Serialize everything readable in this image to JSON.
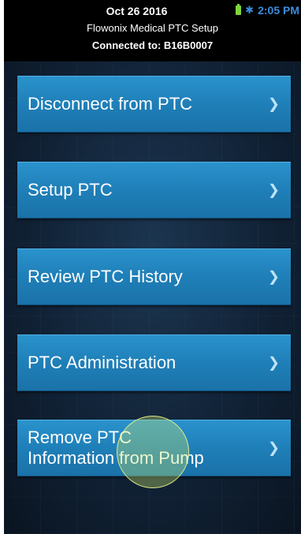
{
  "status_bar": {
    "date": "Oct 26 2016",
    "time": "2:05 PM",
    "battery_icon": "battery-icon",
    "bluetooth_icon": "bluetooth-icon"
  },
  "header": {
    "app_title": "Flowonix Medical PTC Setup",
    "connection": "Connected to: B16B0007"
  },
  "menu": {
    "items": [
      {
        "label": "Disconnect from PTC",
        "icon": "chevron-right-icon"
      },
      {
        "label": "Setup PTC",
        "icon": "chevron-right-icon"
      },
      {
        "label": "Review PTC History",
        "icon": "chevron-right-icon"
      },
      {
        "label": "PTC Administration",
        "icon": "chevron-right-icon"
      },
      {
        "label": "Remove PTC\nInformation from Pump",
        "icon": "chevron-right-icon"
      }
    ]
  },
  "colors": {
    "button_blue": "#1f7fb8",
    "background": "#112236",
    "status_bar": "#000000",
    "time_blue": "#3a8dde",
    "battery_green": "#7cd63a",
    "touch_indicator": "#d4ee7a"
  }
}
